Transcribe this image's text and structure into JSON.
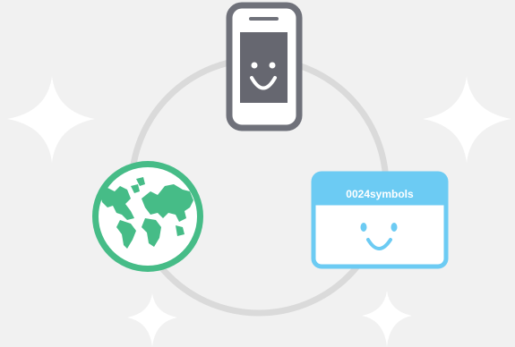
{
  "browser_window": {
    "title": "0024symbols"
  },
  "icons": {
    "phone": "smiling-phone-icon",
    "globe": "globe-icon",
    "window": "smiling-browser-window-icon",
    "sparkles": "sparkle-icon"
  },
  "colors": {
    "background": "#f1f1f1",
    "ring": "#dadada",
    "sparkle": "#ffffff",
    "phone_frame": "#6f717a",
    "phone_screen": "#666770",
    "phone_face": "#ffffff",
    "globe_green": "#46bc87",
    "window_blue": "#6ccbf3",
    "window_text": "#ffffff"
  }
}
